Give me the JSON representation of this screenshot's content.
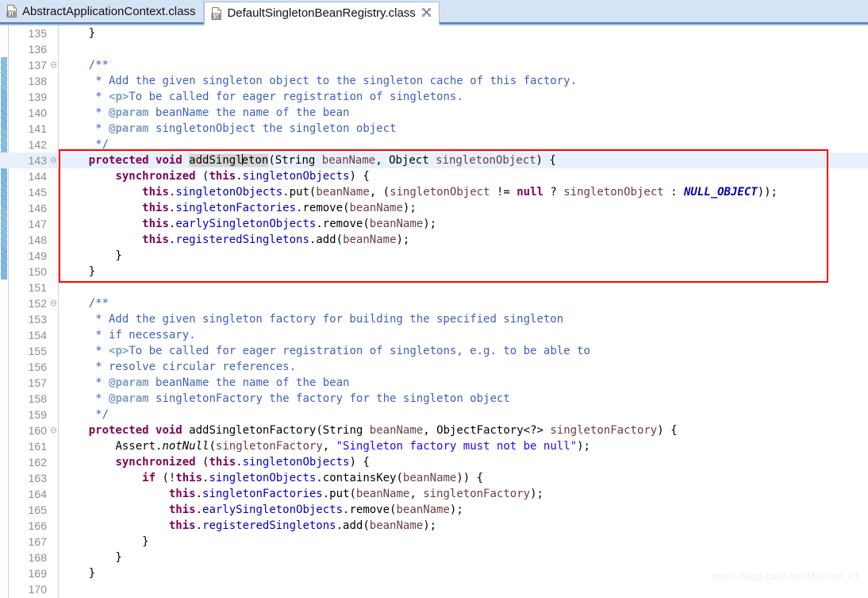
{
  "window": {
    "app": "Eclipse IDE — Java Class File Editor"
  },
  "tabs": [
    {
      "label": "AbstractApplicationContext.class",
      "icon": "class-file-icon",
      "active": false,
      "closable": false
    },
    {
      "label": "DefaultSingletonBeanRegistry.class",
      "icon": "class-file-icon",
      "active": true,
      "closable": true,
      "close_glyph": "✄"
    }
  ],
  "editor": {
    "first_line": 135,
    "last_line": 170,
    "current_line": 143,
    "fold_markers": [
      137,
      143,
      152,
      160
    ],
    "change_bar_lines": [
      137,
      138,
      139,
      140,
      141,
      142,
      143,
      144,
      145,
      146,
      147,
      148,
      149,
      150
    ],
    "selection_text": "addSingleton",
    "caret_line": 143,
    "lines": [
      {
        "n": 135,
        "text": "    }"
      },
      {
        "n": 136,
        "text": ""
      },
      {
        "n": 137,
        "text": "    /**"
      },
      {
        "n": 138,
        "text": "     * Add the given singleton object to the singleton cache of this factory."
      },
      {
        "n": 139,
        "text": "     * <p>To be called for eager registration of singletons."
      },
      {
        "n": 140,
        "text": "     * @param beanName the name of the bean"
      },
      {
        "n": 141,
        "text": "     * @param singletonObject the singleton object"
      },
      {
        "n": 142,
        "text": "     */"
      },
      {
        "n": 143,
        "text": "    protected void addSingleton(String beanName, Object singletonObject) {"
      },
      {
        "n": 144,
        "text": "        synchronized (this.singletonObjects) {"
      },
      {
        "n": 145,
        "text": "            this.singletonObjects.put(beanName, (singletonObject != null ? singletonObject : NULL_OBJECT));"
      },
      {
        "n": 146,
        "text": "            this.singletonFactories.remove(beanName);"
      },
      {
        "n": 147,
        "text": "            this.earlySingletonObjects.remove(beanName);"
      },
      {
        "n": 148,
        "text": "            this.registeredSingletons.add(beanName);"
      },
      {
        "n": 149,
        "text": "        }"
      },
      {
        "n": 150,
        "text": "    }"
      },
      {
        "n": 151,
        "text": ""
      },
      {
        "n": 152,
        "text": "    /**"
      },
      {
        "n": 153,
        "text": "     * Add the given singleton factory for building the specified singleton"
      },
      {
        "n": 154,
        "text": "     * if necessary."
      },
      {
        "n": 155,
        "text": "     * <p>To be called for eager registration of singletons, e.g. to be able to"
      },
      {
        "n": 156,
        "text": "     * resolve circular references."
      },
      {
        "n": 157,
        "text": "     * @param beanName the name of the bean"
      },
      {
        "n": 158,
        "text": "     * @param singletonFactory the factory for the singleton object"
      },
      {
        "n": 159,
        "text": "     */"
      },
      {
        "n": 160,
        "text": "    protected void addSingletonFactory(String beanName, ObjectFactory<?> singletonFactory) {"
      },
      {
        "n": 161,
        "text": "        Assert.notNull(singletonFactory, \"Singleton factory must not be null\");"
      },
      {
        "n": 162,
        "text": "        synchronized (this.singletonObjects) {"
      },
      {
        "n": 163,
        "text": "            if (!this.singletonObjects.containsKey(beanName)) {"
      },
      {
        "n": 164,
        "text": "                this.singletonFactories.put(beanName, singletonFactory);"
      },
      {
        "n": 165,
        "text": "                this.earlySingletonObjects.remove(beanName);"
      },
      {
        "n": 166,
        "text": "                this.registeredSingletons.add(beanName);"
      },
      {
        "n": 167,
        "text": "            }"
      },
      {
        "n": 168,
        "text": "        }"
      },
      {
        "n": 169,
        "text": "    }"
      },
      {
        "n": 170,
        "text": ""
      }
    ]
  },
  "annotation": {
    "type": "red-rectangle",
    "color": "#ff0000",
    "covers_lines": "143-150"
  },
  "watermark": {
    "text": "https://blog.csdn.net/Michael_lcf"
  },
  "colors": {
    "keyword": "#7f0055",
    "field": "#0000c0",
    "string": "#2a00ff",
    "comment": "#3f5fbf",
    "javadoc_tag": "#7f9fbf",
    "local_var": "#6a3e3e",
    "current_line_bg": "#e8f0fc",
    "tab_bar_bg": "#d6e3f5",
    "annotation": "#ff0000"
  }
}
